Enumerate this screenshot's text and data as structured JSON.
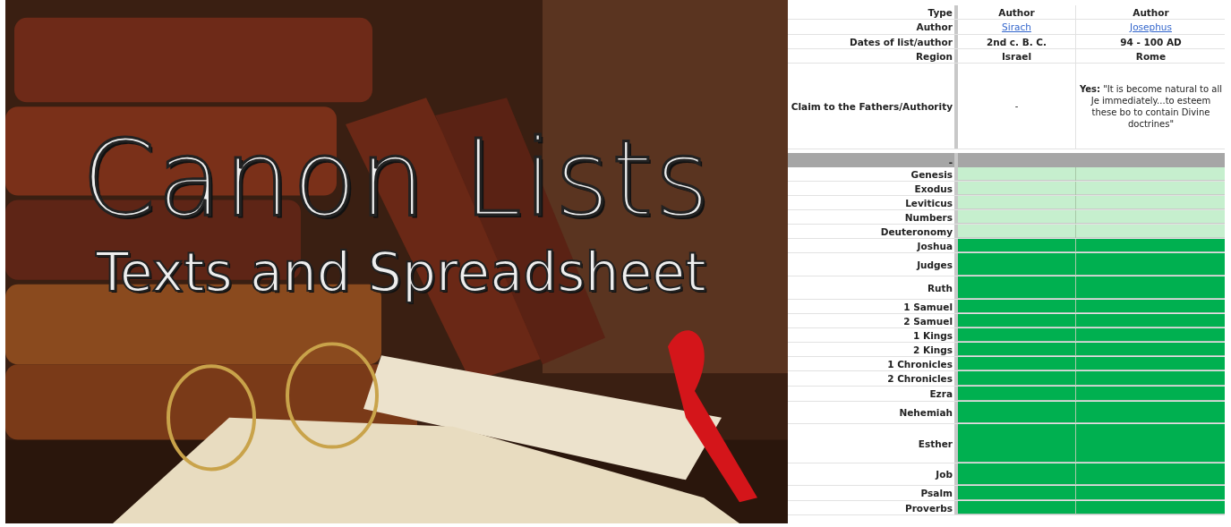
{
  "banner": {
    "title": "Canon Lists",
    "subtitle": "Texts and Spreadsheet"
  },
  "sheet": {
    "header_rows": [
      {
        "label": "Type",
        "cells": [
          {
            "text": "Author",
            "kind": "plain"
          },
          {
            "text": "Author",
            "kind": "plain"
          }
        ]
      },
      {
        "label": "Author",
        "cells": [
          {
            "text": "Sirach",
            "kind": "link"
          },
          {
            "text": "Josephus",
            "kind": "link"
          }
        ]
      },
      {
        "label": "Dates of list/author",
        "cells": [
          {
            "text": "2nd c. B. C.",
            "kind": "plain"
          },
          {
            "text": "94  - 100 AD",
            "kind": "plain"
          }
        ]
      },
      {
        "label": "Region",
        "cells": [
          {
            "text": "Israel",
            "kind": "plain"
          },
          {
            "text": "Rome",
            "kind": "plain"
          }
        ]
      },
      {
        "label": "Claim to the Fathers/Authority",
        "cells": [
          {
            "text": "-",
            "kind": "note"
          },
          {
            "text": "**Yes:** \"It is become natural to all Je immediately...to esteem these bo to contain Divine doctrines\"",
            "kind": "note"
          }
        ]
      }
    ],
    "section_label": "-",
    "books": [
      {
        "name": "Genesis",
        "cells": [
          {
            "color": "#c6efce"
          },
          {
            "color": "#c6efce"
          }
        ]
      },
      {
        "name": "Exodus",
        "cells": [
          {
            "color": "#c6efce"
          },
          {
            "color": "#c6efce"
          }
        ]
      },
      {
        "name": "Leviticus",
        "cells": [
          {
            "color": "#c6efce"
          },
          {
            "color": "#c6efce"
          }
        ]
      },
      {
        "name": "Numbers",
        "cells": [
          {
            "color": "#c6efce"
          },
          {
            "color": "#c6efce"
          }
        ]
      },
      {
        "name": "Deuteronomy",
        "cells": [
          {
            "color": "#c6efce"
          },
          {
            "color": "#c6efce"
          }
        ]
      },
      {
        "name": "Joshua",
        "cells": [
          {
            "color": "#00b050"
          },
          {
            "color": "#00b050"
          }
        ]
      },
      {
        "name": "Judges",
        "cells": [
          {
            "color": "#00b050"
          },
          {
            "color": "#00b050"
          }
        ]
      },
      {
        "name": "Ruth",
        "cells": [
          {
            "color": "#00b050"
          },
          {
            "color": "#00b050"
          }
        ]
      },
      {
        "name": "1 Samuel",
        "cells": [
          {
            "color": "#00b050"
          },
          {
            "color": "#00b050"
          }
        ]
      },
      {
        "name": "2 Samuel",
        "cells": [
          {
            "color": "#00b050"
          },
          {
            "color": "#00b050"
          }
        ]
      },
      {
        "name": "1 Kings",
        "cells": [
          {
            "color": "#00b050"
          },
          {
            "color": "#00b050"
          }
        ]
      },
      {
        "name": "2 Kings",
        "cells": [
          {
            "color": "#00b050"
          },
          {
            "color": "#00b050"
          }
        ]
      },
      {
        "name": "1 Chronicles",
        "cells": [
          {
            "color": "#00b050"
          },
          {
            "color": "#00b050"
          }
        ]
      },
      {
        "name": "2 Chronicles",
        "cells": [
          {
            "color": "#00b050"
          },
          {
            "color": "#00b050"
          }
        ]
      },
      {
        "name": "Ezra",
        "cells": [
          {
            "color": "#00b050"
          },
          {
            "color": "#00b050"
          }
        ]
      },
      {
        "name": "Nehemiah",
        "cells": [
          {
            "color": "#00b050"
          },
          {
            "color": "#00b050"
          }
        ]
      },
      {
        "name": "Esther",
        "cells": [
          {
            "color": "#00b050"
          },
          {
            "color": "#00b050"
          }
        ]
      },
      {
        "name": "Job",
        "cells": [
          {
            "color": "#00b050"
          },
          {
            "color": "#00b050"
          }
        ]
      },
      {
        "name": "Psalm",
        "cells": [
          {
            "color": "#00b050"
          },
          {
            "color": "#00b050"
          }
        ]
      },
      {
        "name": "Proverbs",
        "cells": [
          {
            "color": "#00b050"
          },
          {
            "color": "#00b050"
          }
        ]
      }
    ]
  }
}
